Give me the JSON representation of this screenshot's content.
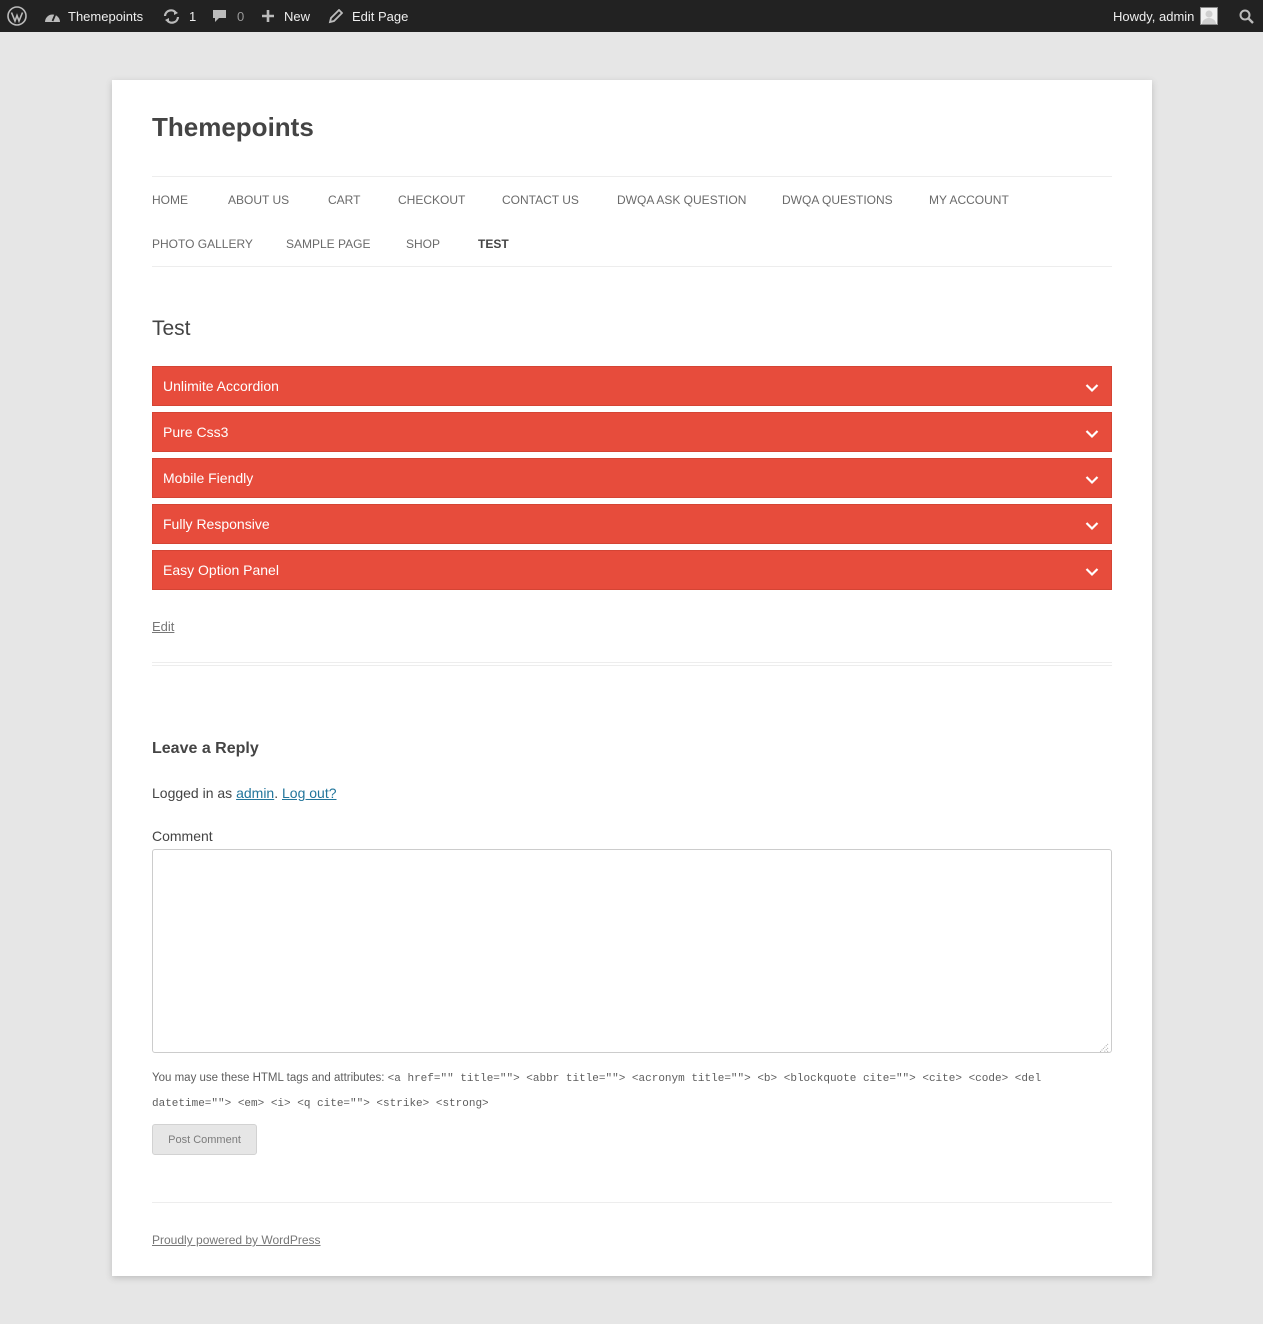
{
  "adminbar": {
    "wp_logo_icon": "wordpress-logo-icon",
    "site_name": "Themepoints",
    "updates_count": "1",
    "comments_count": "0",
    "new_label": "New",
    "edit_label": "Edit Page",
    "howdy": "Howdy, admin"
  },
  "site": {
    "title": "Themepoints"
  },
  "nav": {
    "items": [
      {
        "label": "HOME"
      },
      {
        "label": "ABOUT US"
      },
      {
        "label": "CART"
      },
      {
        "label": "CHECKOUT"
      },
      {
        "label": "CONTACT US"
      },
      {
        "label": "DWQA ASK QUESTION"
      },
      {
        "label": "DWQA QUESTIONS"
      },
      {
        "label": "MY ACCOUNT"
      },
      {
        "label": "PHOTO GALLERY"
      },
      {
        "label": "SAMPLE PAGE"
      },
      {
        "label": "SHOP"
      },
      {
        "label": "TEST",
        "current": true
      }
    ]
  },
  "entry": {
    "title": "Test",
    "accordion": [
      {
        "label": "Unlimite Accordion"
      },
      {
        "label": "Pure Css3"
      },
      {
        "label": "Mobile Fiendly"
      },
      {
        "label": "Fully Responsive"
      },
      {
        "label": "Easy Option Panel"
      }
    ],
    "accordion_color": "#e74c3c",
    "edit_label": "Edit"
  },
  "comments": {
    "reply_title": "Leave a Reply",
    "logged_in_prefix": "Logged in as ",
    "logged_in_user": "admin",
    "logged_in_sep": ". ",
    "logout_label": "Log out?",
    "comment_label": "Comment",
    "comment_value": "",
    "allowed_intro": "You may use these HTML tags and attributes: ",
    "allowed_code": "<a href=\"\" title=\"\"> <abbr title=\"\"> <acronym title=\"\"> <b> <blockquote cite=\"\"> <cite> <code> <del datetime=\"\"> <em> <i> <q cite=\"\"> <strike> <strong>",
    "submit_label": "Post Comment"
  },
  "footer": {
    "powered_by": "Proudly powered by WordPress"
  },
  "colors": {
    "adminbar_bg": "#222222",
    "page_bg": "#e6e6e6",
    "link": "#21759b"
  }
}
